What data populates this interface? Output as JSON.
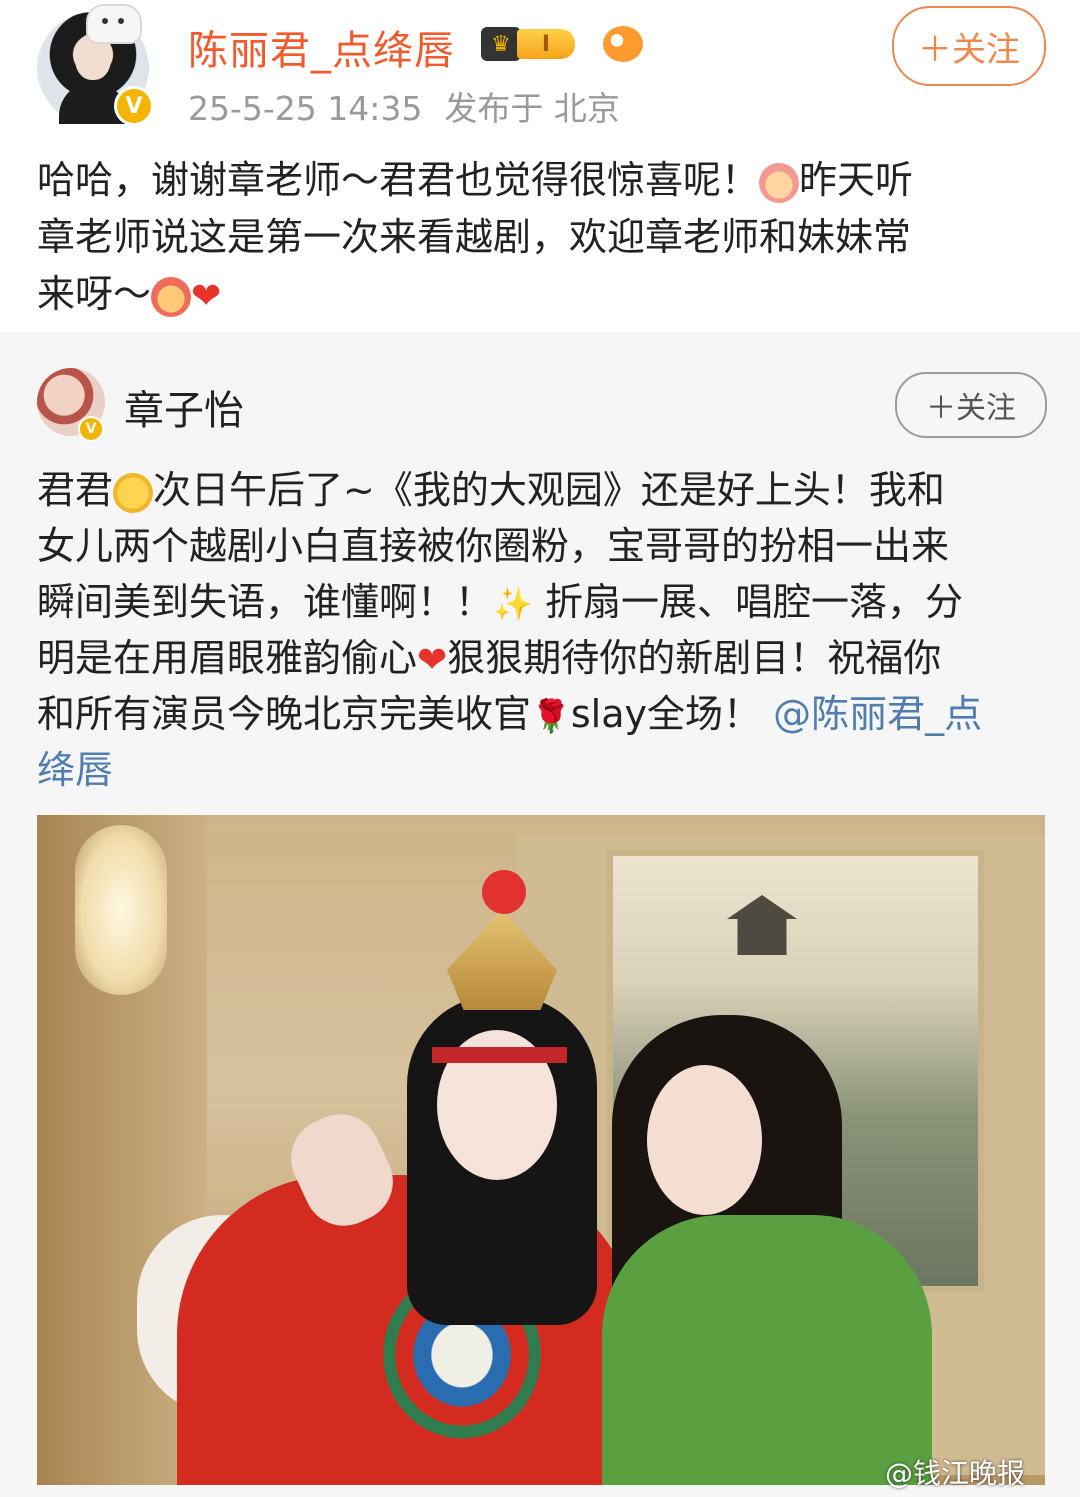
{
  "post": {
    "author": "陈丽君_点绛唇",
    "rank_level": "I",
    "meta_time": "25-5-25 14:35",
    "meta_location": "发布于 北京",
    "follow_label": "＋关注",
    "text_lines": [
      "哈哈，谢谢章老师～君君也觉得很惊喜呢！",
      "昨天听",
      "章老师说这是第一次来看越剧，欢迎章老师和妹妹常",
      "来呀～"
    ]
  },
  "repost": {
    "author": "章子怡",
    "follow_label": "＋关注",
    "text": {
      "l1a": "君君",
      "l1b": "次日午后了~《我的大观园》还是好上头！我和",
      "l2": "女儿两个越剧小白直接被你圈粉，宝哥哥的扮相一出来",
      "l3a": "瞬间美到失语，谁懂啊！！",
      "l3b": " 折扇一展、唱腔一落，分",
      "l4a": "明是在用眉眼雅韵偷心",
      "l4b": "狠狠期待你的新剧目！祝福你",
      "l5a": "和所有演员今晚北京完美收官",
      "l5b": "slay全场！",
      "l5c": "@陈丽君_点",
      "l6": "绛唇"
    }
  },
  "watermark": "@钱江晚报",
  "colors": {
    "name_orange": "#f25a2b",
    "follow_orange": "#f0874f",
    "mention_blue": "#507daf",
    "repost_bg": "#f6f6f6"
  }
}
